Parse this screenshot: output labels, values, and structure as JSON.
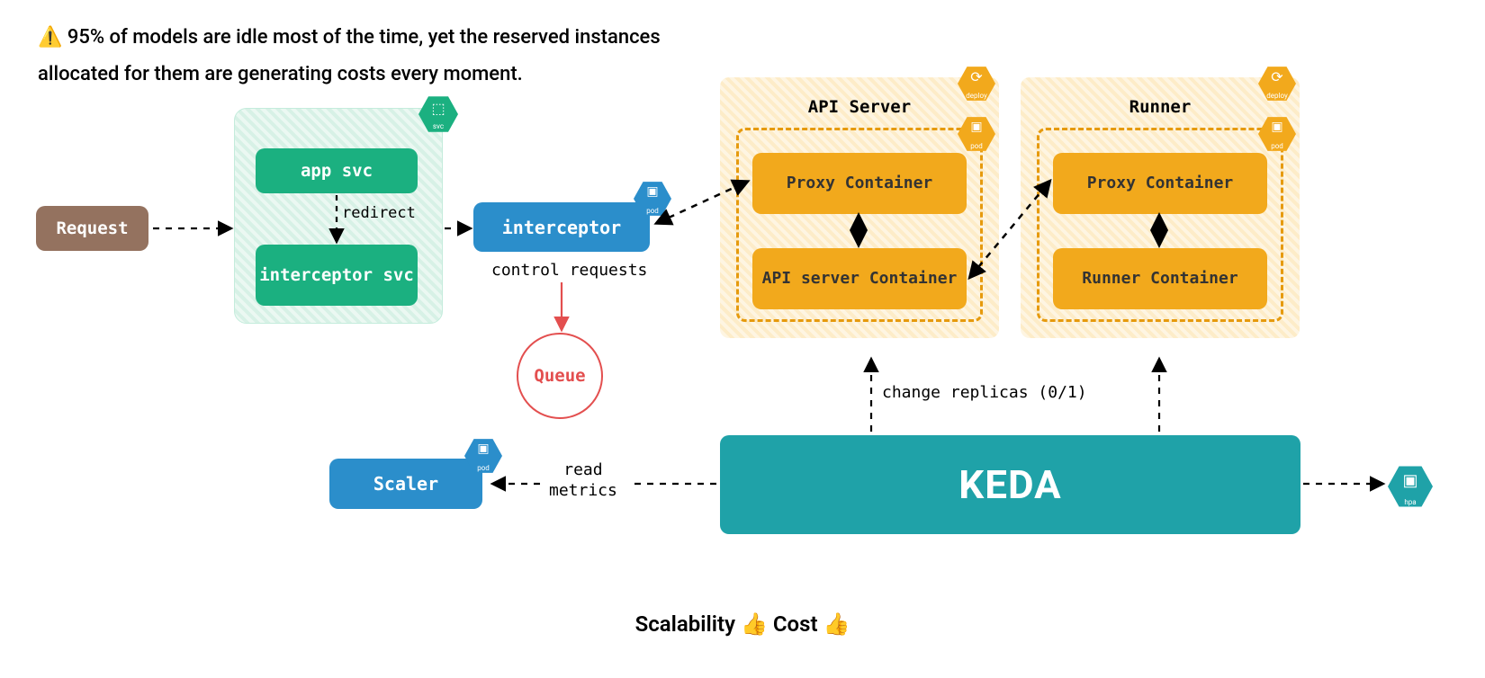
{
  "warning": {
    "icon": "⚠️",
    "text": "95% of models are idle most of the time, yet the reserved instances allocated for them are generating costs every moment."
  },
  "nodes": {
    "request": "Request",
    "app_svc": "app svc",
    "interceptor_svc": "interceptor svc",
    "interceptor": "interceptor",
    "queue": "Queue",
    "scaler": "Scaler",
    "keda": "KEDA"
  },
  "pods": {
    "api": {
      "title": "API Server",
      "proxy": "Proxy Container",
      "lower": "API server Container"
    },
    "runner": {
      "title": "Runner",
      "proxy": "Proxy Container",
      "lower": "Runner Container"
    }
  },
  "labels": {
    "redirect": "redirect",
    "control_requests": "control requests",
    "read_metrics_1": "read",
    "read_metrics_2": "metrics",
    "change_replicas": "change replicas (0/1)"
  },
  "badges": {
    "svc": "svc",
    "pod": "pod",
    "deploy": "deploy",
    "hpa": "hpa"
  },
  "footer": {
    "scalability": "Scalability",
    "cost": "Cost",
    "thumbs": "👍"
  }
}
